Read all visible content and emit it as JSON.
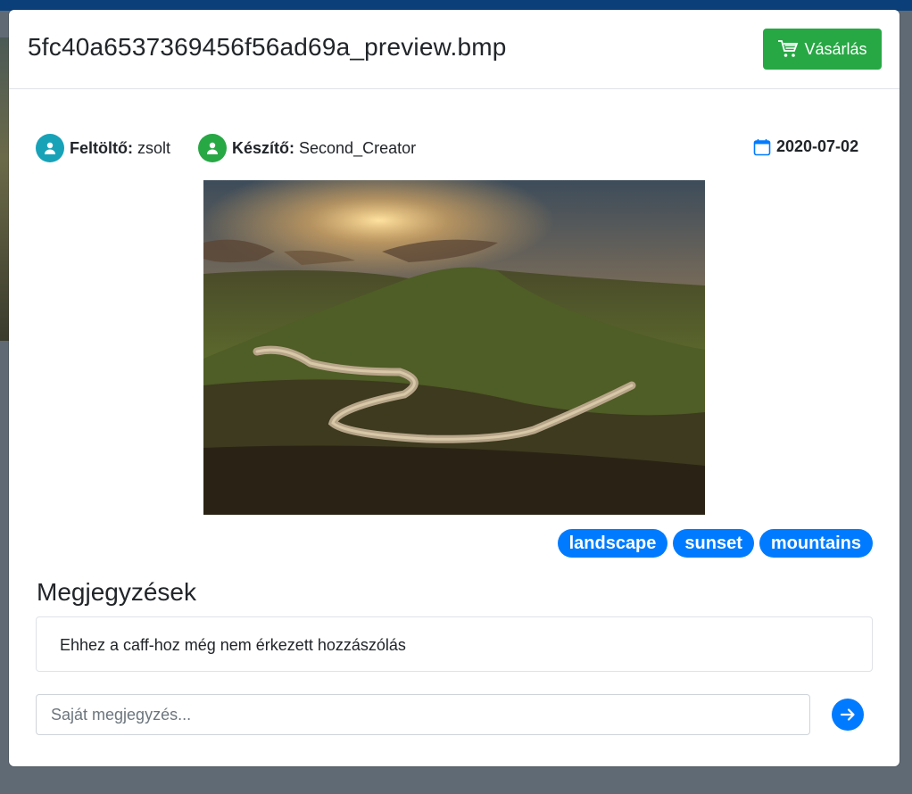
{
  "modal": {
    "title": "5fc40a6537369456f56ad69a_preview.bmp",
    "buy_label": "Vásárlás"
  },
  "meta": {
    "uploader_label": "Feltöltő:",
    "uploader_value": "zsolt",
    "creator_label": "Készítő:",
    "creator_value": "Second_Creator",
    "date": "2020-07-02"
  },
  "tags": [
    "landscape",
    "sunset",
    "mountains"
  ],
  "comments": {
    "title": "Megjegyzések",
    "empty_text": "Ehhez a caff-hoz még nem érkezett hozzászólás",
    "input_placeholder": "Saját megjegyzés..."
  },
  "colors": {
    "success": "#28a745",
    "primary": "#007bff",
    "uploader_avatar": "#17a2b8",
    "creator_avatar": "#28a745"
  },
  "icons": [
    "cart-icon",
    "user-icon",
    "calendar-icon",
    "arrow-right-icon"
  ]
}
